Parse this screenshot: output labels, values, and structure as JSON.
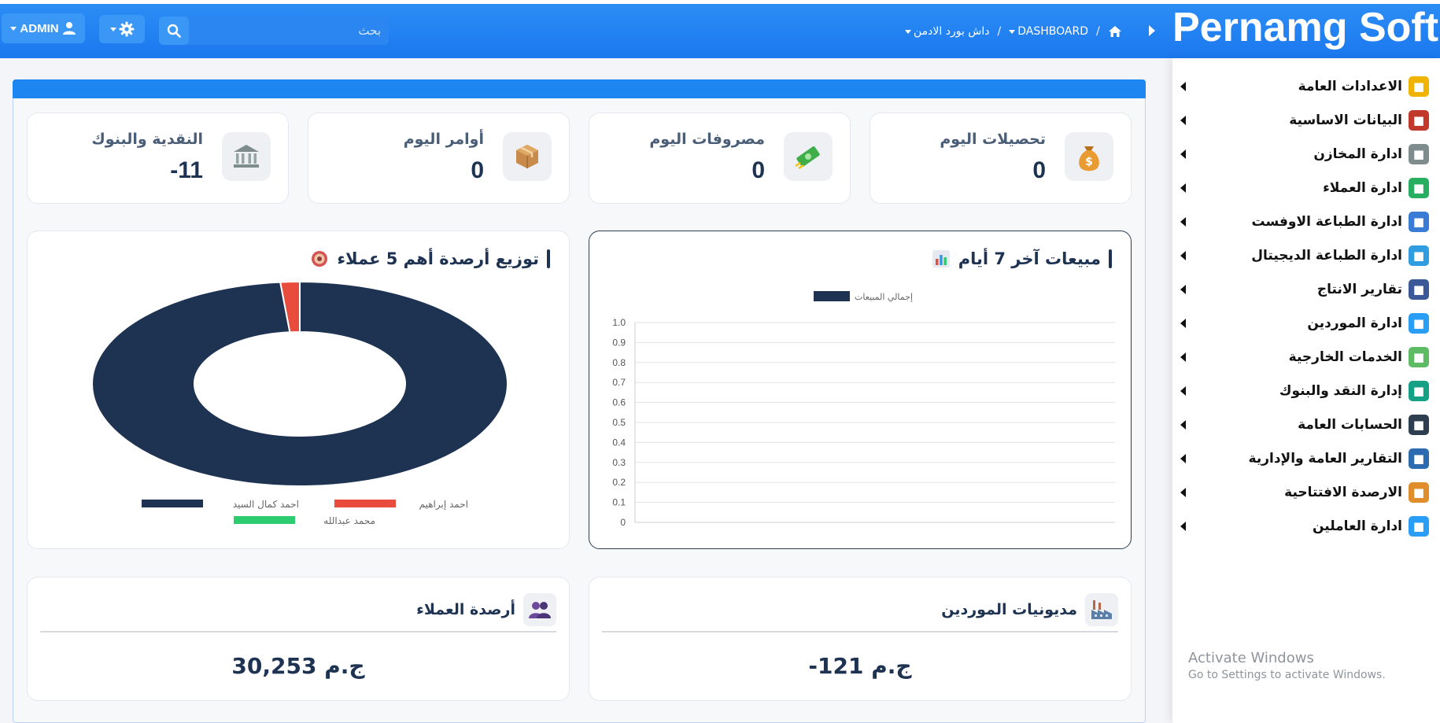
{
  "header": {
    "brand": "Pernamg Soft",
    "admin_label": "ADMIN",
    "search_placeholder": "بحث",
    "breadcrumb": [
      {
        "label": "DASHBOARD"
      },
      {
        "label": "داش بورد الادمن"
      }
    ]
  },
  "stats": [
    {
      "title": "تحصيلات اليوم",
      "value": "0",
      "icon": "money-bag-icon"
    },
    {
      "title": "مصروفات اليوم",
      "value": "0",
      "icon": "cash-flying-icon"
    },
    {
      "title": "أوامر اليوم",
      "value": "0",
      "icon": "package-icon"
    },
    {
      "title": "النقدية والبنوك",
      "value": "-11",
      "icon": "bank-icon"
    }
  ],
  "sales_panel": {
    "title": "مبيعات آخر 7 أيام",
    "legend": "إجمالي المبيعات",
    "y_ticks": [
      "1.0",
      "0.9",
      "0.8",
      "0.7",
      "0.6",
      "0.5",
      "0.4",
      "0.3",
      "0.2",
      "0.1",
      "0"
    ]
  },
  "customers_panel": {
    "title": "توزيع أرصدة أهم 5 عملاء"
  },
  "chart_data": [
    {
      "type": "bar",
      "title": "مبيعات آخر 7 أيام",
      "categories": [],
      "series": [
        {
          "name": "إجمالي المبيعات",
          "values": []
        }
      ],
      "ylim": [
        0,
        1.0
      ],
      "grid": true,
      "legend": "top"
    },
    {
      "type": "pie",
      "title": "توزيع أرصدة أهم 5 عملاء",
      "labels": [
        "احمد كمال السيد",
        "احمد إبراهيم",
        "محمد عبدالله"
      ],
      "values": [
        98.5,
        1.5,
        0
      ],
      "colors": [
        "#1e3352",
        "#e74c3c",
        "#2ecc71"
      ],
      "legend": "bottom"
    }
  ],
  "donut_legend": [
    {
      "label": "احمد إبراهيم",
      "color": "#e74c3c"
    },
    {
      "label": "احمد كمال السيد",
      "color": "#1e3352"
    },
    {
      "label": "محمد عبدالله",
      "color": "#2ecc71"
    }
  ],
  "bottom_cards": [
    {
      "title": "مديونيات الموردين",
      "value": "-121 ج.م",
      "icon": "factory-icon"
    },
    {
      "title": "أرصدة العملاء",
      "value": "30,253 ج.م",
      "icon": "people-icon"
    }
  ],
  "sidebar": {
    "items": [
      {
        "label": "الاعدادات العامة",
        "icon": "gear-icon",
        "color": "#f0b400"
      },
      {
        "label": "البيانات الاساسية",
        "icon": "bar-chart-icon",
        "color": "#c0392b"
      },
      {
        "label": "ادارة المخازن",
        "icon": "warehouse-icon",
        "color": "#7f8c8d"
      },
      {
        "label": "ادارة العملاء",
        "icon": "customers-icon",
        "color": "#27ae60"
      },
      {
        "label": "ادارة الطباعة الاوفست",
        "icon": "printer-icon",
        "color": "#3a7bd5"
      },
      {
        "label": "ادارة الطباعة الديجيتال",
        "icon": "digital-printer-icon",
        "color": "#2f9de0"
      },
      {
        "label": "تقارير الانتاج",
        "icon": "report-icon",
        "color": "#3b5998"
      },
      {
        "label": "ادارة الموردين",
        "icon": "supplier-icon",
        "color": "#2a9df4"
      },
      {
        "label": "الخدمات الخارجية",
        "icon": "services-icon",
        "color": "#5dbb63"
      },
      {
        "label": "إدارة النقد والبنوك",
        "icon": "cash-bag-icon",
        "color": "#16a085"
      },
      {
        "label": "الحسابات العامة",
        "icon": "ledger-icon",
        "color": "#2c3e50"
      },
      {
        "label": "التقارير العامة والإدارية",
        "icon": "admin-report-icon",
        "color": "#2c6bb0"
      },
      {
        "label": "الارصدة الافتتاحية",
        "icon": "opening-balance-icon",
        "color": "#e08e2b"
      },
      {
        "label": "ادارة العاملين",
        "icon": "employees-icon",
        "color": "#2a9df4"
      }
    ]
  },
  "watermark": {
    "line1": "Activate Windows",
    "line2": "Go to Settings to activate Windows."
  }
}
